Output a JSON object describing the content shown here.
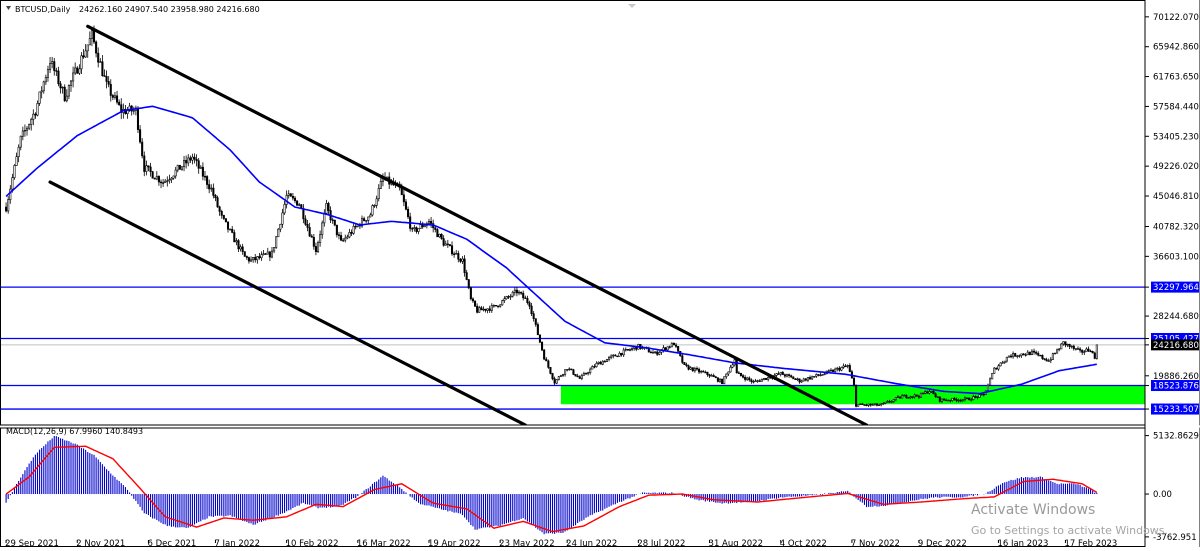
{
  "header": {
    "symbol": "BTCUSD,Daily",
    "ohlc": "24262.160 24907.540 23958.980 24216.680"
  },
  "macd_label": "MACD(12,26,9) 67.9960 140.8493",
  "watermark": {
    "line1": "Activate Windows",
    "line2": "Go to Settings to activate Windows."
  },
  "colors": {
    "candle": "#000000",
    "ma_line": "#0000ff",
    "hlines": "#0000ff",
    "support_zone": "#00ff00",
    "trend_channel": "#000000",
    "macd_hist": "#0000cc",
    "macd_signal": "#ff0000",
    "price_tag_bg": "#0000ff",
    "current_price_bg": "#000000"
  },
  "chart_data": [
    {
      "type": "candlestick",
      "title": "BTCUSD,Daily",
      "ylim": [
        13000,
        71500
      ],
      "y_ticks": [
        "70122.070",
        "65942.860",
        "61763.650",
        "57584.440",
        "53405.230",
        "49226.020",
        "45046.810",
        "40782.320",
        "36603.100",
        "32297.964",
        "28244.680",
        "25105.427",
        "24216.680",
        "19886.260",
        "18523.876",
        "15233.507"
      ],
      "x_ticks": [
        "29 Sep 2021",
        "2 Nov 2021",
        "6 Dec 2021",
        "7 Jan 2022",
        "10 Feb 2022",
        "16 Mar 2022",
        "19 Apr 2022",
        "23 May 2022",
        "24 Jun 2022",
        "28 Jul 2022",
        "31 Aug 2022",
        "4 Oct 2022",
        "7 Nov 2022",
        "9 Dec 2022",
        "16 Jan 2023",
        "17 Feb 2023"
      ],
      "close_series": {
        "x_start": "2021-09-29",
        "x_end": "2023-03-04",
        "anchors": [
          [
            "2021-09-29",
            43500
          ],
          [
            "2021-10-06",
            53000
          ],
          [
            "2021-10-13",
            57000
          ],
          [
            "2021-10-20",
            64000
          ],
          [
            "2021-10-27",
            59000
          ],
          [
            "2021-11-02",
            63000
          ],
          [
            "2021-11-09",
            67500
          ],
          [
            "2021-11-16",
            60500
          ],
          [
            "2021-11-23",
            57000
          ],
          [
            "2021-11-30",
            57000
          ],
          [
            "2021-12-04",
            49000
          ],
          [
            "2021-12-13",
            47000
          ],
          [
            "2021-12-21",
            49000
          ],
          [
            "2021-12-27",
            50500
          ],
          [
            "2022-01-05",
            46000
          ],
          [
            "2022-01-10",
            42000
          ],
          [
            "2022-01-21",
            36500
          ],
          [
            "2022-01-24",
            36000
          ],
          [
            "2022-02-03",
            37000
          ],
          [
            "2022-02-10",
            45000
          ],
          [
            "2022-02-16",
            44000
          ],
          [
            "2022-02-24",
            37500
          ],
          [
            "2022-03-01",
            43500
          ],
          [
            "2022-03-08",
            38500
          ],
          [
            "2022-03-16",
            41000
          ],
          [
            "2022-03-22",
            42500
          ],
          [
            "2022-03-28",
            47500
          ],
          [
            "2022-04-05",
            46000
          ],
          [
            "2022-04-11",
            40000
          ],
          [
            "2022-04-19",
            41500
          ],
          [
            "2022-04-26",
            38500
          ],
          [
            "2022-05-05",
            36000
          ],
          [
            "2022-05-09",
            30500
          ],
          [
            "2022-05-12",
            29000
          ],
          [
            "2022-05-20",
            29500
          ],
          [
            "2022-05-31",
            31700
          ],
          [
            "2022-06-06",
            30000
          ],
          [
            "2022-06-13",
            22500
          ],
          [
            "2022-06-18",
            19000
          ],
          [
            "2022-06-24",
            21000
          ],
          [
            "2022-06-30",
            19500
          ],
          [
            "2022-07-08",
            21500
          ],
          [
            "2022-07-19",
            23000
          ],
          [
            "2022-07-28",
            24000
          ],
          [
            "2022-08-05",
            23000
          ],
          [
            "2022-08-14",
            24400
          ],
          [
            "2022-08-19",
            21200
          ],
          [
            "2022-08-31",
            20000
          ],
          [
            "2022-09-06",
            19000
          ],
          [
            "2022-09-12",
            22200
          ],
          [
            "2022-09-13",
            20200
          ],
          [
            "2022-09-21",
            19000
          ],
          [
            "2022-10-04",
            20200
          ],
          [
            "2022-10-13",
            19200
          ],
          [
            "2022-10-25",
            20200
          ],
          [
            "2022-11-05",
            21300
          ],
          [
            "2022-11-08",
            18500
          ],
          [
            "2022-11-09",
            15800
          ],
          [
            "2022-11-21",
            15800
          ],
          [
            "2022-12-01",
            17000
          ],
          [
            "2022-12-09",
            17100
          ],
          [
            "2022-12-14",
            17800
          ],
          [
            "2022-12-19",
            16500
          ],
          [
            "2023-01-01",
            16600
          ],
          [
            "2023-01-09",
            17200
          ],
          [
            "2023-01-14",
            20800
          ],
          [
            "2023-01-21",
            22700
          ],
          [
            "2023-02-01",
            23100
          ],
          [
            "2023-02-09",
            22000
          ],
          [
            "2023-02-16",
            24500
          ],
          [
            "2023-02-24",
            23200
          ],
          [
            "2023-03-01",
            23600
          ],
          [
            "2023-03-03",
            22300
          ],
          [
            "2023-03-04",
            24216
          ]
        ]
      },
      "moving_average": {
        "name": "MA",
        "anchors": [
          [
            "2021-09-29",
            45000
          ],
          [
            "2021-10-14",
            49000
          ],
          [
            "2021-11-02",
            53500
          ],
          [
            "2021-11-24",
            57000
          ],
          [
            "2021-12-08",
            57600
          ],
          [
            "2021-12-27",
            56000
          ],
          [
            "2022-01-14",
            51500
          ],
          [
            "2022-01-28",
            47000
          ],
          [
            "2022-02-14",
            43500
          ],
          [
            "2022-03-01",
            42500
          ],
          [
            "2022-03-17",
            41000
          ],
          [
            "2022-04-01",
            41500
          ],
          [
            "2022-04-21",
            41000
          ],
          [
            "2022-05-07",
            39000
          ],
          [
            "2022-05-26",
            35000
          ],
          [
            "2022-06-08",
            31500
          ],
          [
            "2022-06-23",
            27500
          ],
          [
            "2022-07-12",
            24500
          ],
          [
            "2022-08-01",
            23800
          ],
          [
            "2022-08-22",
            22800
          ],
          [
            "2022-09-12",
            21700
          ],
          [
            "2022-10-06",
            20900
          ],
          [
            "2022-11-04",
            20100
          ],
          [
            "2022-11-28",
            18800
          ],
          [
            "2022-12-21",
            17700
          ],
          [
            "2023-01-07",
            17400
          ],
          [
            "2023-01-27",
            18700
          ],
          [
            "2023-02-14",
            20600
          ],
          [
            "2023-03-04",
            21500
          ]
        ]
      },
      "horizontal_lines": [
        32297.964,
        25105.427,
        18523.876,
        15233.507
      ],
      "current_price": 24216.68,
      "support_zone": {
        "x_from": "2022-06-21",
        "x_to": "2023-03-31",
        "y_from": 15900,
        "y_to": 18523.876
      },
      "trend_lines": [
        {
          "from": [
            "2021-11-07",
            68800
          ],
          "to": [
            "2022-11-14",
            13000
          ]
        },
        {
          "from": [
            "2021-10-20",
            47000
          ],
          "to": [
            "2022-06-04",
            13000
          ]
        }
      ]
    },
    {
      "type": "bar",
      "title": "MACD(12,26,9) 67.9960 140.8493",
      "ylim": [
        -4300,
        5800
      ],
      "y_ticks": [
        "5132.8629",
        "0.00",
        "-3762.951"
      ],
      "histogram_anchors": [
        [
          "2021-09-29",
          -800
        ],
        [
          "2021-10-06",
          1500
        ],
        [
          "2021-10-13",
          3500
        ],
        [
          "2021-10-22",
          5100
        ],
        [
          "2021-11-01",
          4400
        ],
        [
          "2021-11-10",
          3400
        ],
        [
          "2021-11-16",
          2200
        ],
        [
          "2021-11-26",
          400
        ],
        [
          "2021-12-04",
          -1700
        ],
        [
          "2021-12-15",
          -2800
        ],
        [
          "2021-12-25",
          -3000
        ],
        [
          "2022-01-04",
          -2000
        ],
        [
          "2022-01-14",
          -1900
        ],
        [
          "2022-01-25",
          -2700
        ],
        [
          "2022-02-08",
          -1700
        ],
        [
          "2022-02-18",
          -800
        ],
        [
          "2022-02-25",
          -1200
        ],
        [
          "2022-03-07",
          -1100
        ],
        [
          "2022-03-16",
          -200
        ],
        [
          "2022-03-28",
          1600
        ],
        [
          "2022-04-05",
          600
        ],
        [
          "2022-04-14",
          -800
        ],
        [
          "2022-04-24",
          -1300
        ],
        [
          "2022-05-05",
          -1800
        ],
        [
          "2022-05-11",
          -3100
        ],
        [
          "2022-05-22",
          -2800
        ],
        [
          "2022-06-03",
          -2100
        ],
        [
          "2022-06-13",
          -3500
        ],
        [
          "2022-06-22",
          -3400
        ],
        [
          "2022-07-04",
          -2000
        ],
        [
          "2022-07-19",
          -700
        ],
        [
          "2022-07-30",
          100
        ],
        [
          "2022-08-14",
          100
        ],
        [
          "2022-08-25",
          -500
        ],
        [
          "2022-09-06",
          -800
        ],
        [
          "2022-09-20",
          -700
        ],
        [
          "2022-10-04",
          -300
        ],
        [
          "2022-10-20",
          -100
        ],
        [
          "2022-11-05",
          250
        ],
        [
          "2022-11-14",
          -1100
        ],
        [
          "2022-11-24",
          -1000
        ],
        [
          "2022-12-05",
          -600
        ],
        [
          "2022-12-16",
          -300
        ],
        [
          "2022-12-31",
          -250
        ],
        [
          "2023-01-10",
          50
        ],
        [
          "2023-01-18",
          1000
        ],
        [
          "2023-01-27",
          1450
        ],
        [
          "2023-02-05",
          1500
        ],
        [
          "2023-02-13",
          900
        ],
        [
          "2023-02-22",
          900
        ],
        [
          "2023-03-01",
          400
        ],
        [
          "2023-03-04",
          68
        ]
      ],
      "signal_anchors": [
        [
          "2021-09-29",
          0
        ],
        [
          "2021-10-10",
          1500
        ],
        [
          "2021-10-22",
          4100
        ],
        [
          "2021-11-06",
          4200
        ],
        [
          "2021-11-19",
          3100
        ],
        [
          "2021-12-01",
          700
        ],
        [
          "2021-12-14",
          -2000
        ],
        [
          "2021-12-29",
          -2900
        ],
        [
          "2022-01-11",
          -2100
        ],
        [
          "2022-01-25",
          -2300
        ],
        [
          "2022-02-10",
          -2000
        ],
        [
          "2022-02-24",
          -900
        ],
        [
          "2022-03-09",
          -1100
        ],
        [
          "2022-03-24",
          400
        ],
        [
          "2022-04-06",
          900
        ],
        [
          "2022-04-21",
          -800
        ],
        [
          "2022-05-07",
          -1300
        ],
        [
          "2022-05-20",
          -3000
        ],
        [
          "2022-06-03",
          -2400
        ],
        [
          "2022-06-17",
          -3300
        ],
        [
          "2022-07-02",
          -2800
        ],
        [
          "2022-07-19",
          -1100
        ],
        [
          "2022-08-02",
          -100
        ],
        [
          "2022-08-18",
          0
        ],
        [
          "2022-09-02",
          -500
        ],
        [
          "2022-09-23",
          -700
        ],
        [
          "2022-10-15",
          -300
        ],
        [
          "2022-11-05",
          50
        ],
        [
          "2022-11-22",
          -900
        ],
        [
          "2022-12-10",
          -700
        ],
        [
          "2022-12-31",
          -400
        ],
        [
          "2023-01-14",
          -250
        ],
        [
          "2023-01-28",
          1100
        ],
        [
          "2023-02-11",
          1300
        ],
        [
          "2023-02-25",
          900
        ],
        [
          "2023-03-04",
          141
        ]
      ]
    }
  ]
}
